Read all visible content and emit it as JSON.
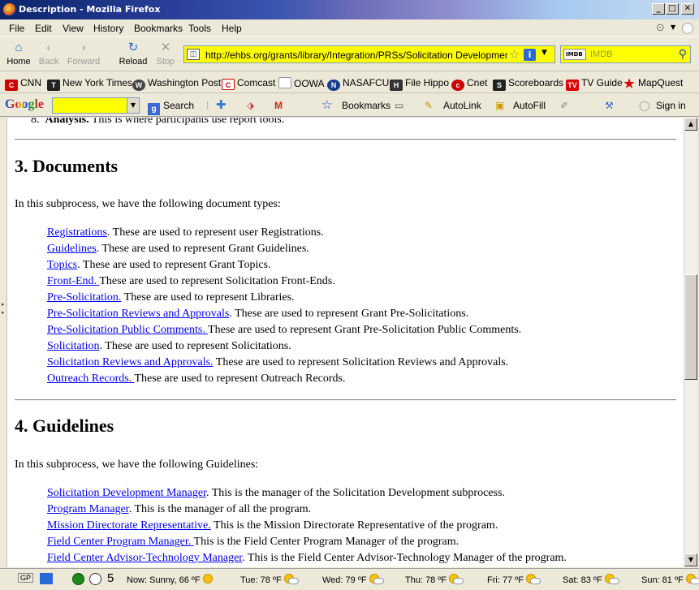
{
  "window": {
    "title": "Description - Mozilla Firefox"
  },
  "menu": [
    "File",
    "Edit",
    "View",
    "History",
    "Bookmarks",
    "Tools",
    "Help"
  ],
  "nav": {
    "home": "Home",
    "back": "Back",
    "forward": "Forward",
    "reload": "Reload",
    "stop": "Stop"
  },
  "address": {
    "url": "http://ehbs.org/grants/library/Integration/PRSs/Solicitation Development/De"
  },
  "search": {
    "engine": "IMDB",
    "placeholder": "IMDB"
  },
  "bookmarks": [
    "CNN",
    "New York Times",
    "Washington Post",
    "Comcast",
    "OOWA",
    "NASAFCU",
    "File Hippo",
    "Cnet",
    "Scoreboards",
    "TV Guide",
    "MapQuest"
  ],
  "google_toolbar": {
    "logo": "Google",
    "search": "Search",
    "bookmarks": "Bookmarks",
    "autolink": "AutoLink",
    "autofill": "AutoFill",
    "signin": "Sign in"
  },
  "content": {
    "prev_item": {
      "num": "8.",
      "bold": "Analysis.",
      "text": " This is where participants use report tools."
    },
    "documents": {
      "heading": "3. Documents",
      "intro": "In this subprocess, we have the following document types:",
      "items": [
        {
          "link": "Registrations",
          "text": ". These are used to represent user Registrations."
        },
        {
          "link": "Guidelines",
          "text": ". These are used to represent Grant Guidelines."
        },
        {
          "link": "Topics",
          "text": ". These are used to represent Grant Topics."
        },
        {
          "link": "Front-End. ",
          "text": "These are used to represent Solicitation Front-Ends."
        },
        {
          "link": "Pre-Solicitation.",
          "text": " These are used to represent Libraries."
        },
        {
          "link": "Pre-Solicitation Reviews and Approvals",
          "text": ". These are used to represent Grant Pre-Solicitations."
        },
        {
          "link": "Pre-Solicitation Public Comments. ",
          "text": "These are used to represent Grant Pre-Solicitation Public Comments."
        },
        {
          "link": "Solicitation",
          "text": ". These are used to represent Solicitations."
        },
        {
          "link": "Solicitation Reviews and Approvals.",
          "text": " These are used to represent Solicitation Reviews and Approvals."
        },
        {
          "link": "Outreach Records. ",
          "text": "These are used to represent Outreach Records."
        }
      ]
    },
    "guidelines": {
      "heading": "4. Guidelines",
      "intro": "In this subprocess, we have the following Guidelines:",
      "items": [
        {
          "link": "Solicitation Development Manager",
          "text": ". This is the manager of the Solicitation Development subprocess."
        },
        {
          "link": "Program Manager",
          "text": ". This is the manager of all the program."
        },
        {
          "link": "Mission Directorate Representative.",
          "text": " This is the Mission Directorate Representative of the program."
        },
        {
          "link": "Field Center Program Manager. ",
          "text": "This is the Field Center Program Manager of the program."
        },
        {
          "link": "Field Center Advisor-Technology Manager",
          "text": ". This is the Field Center Advisor-Technology Manager of the program."
        }
      ]
    }
  },
  "status": {
    "gp": "GP",
    "count": "5",
    "now": "Now: Sunny, 66 ºF",
    "forecast": [
      "Tue: 78 ºF",
      "Wed: 79 ºF",
      "Thu: 78 ºF",
      "Fri: 77 ºF",
      "Sat: 83 ºF",
      "Sun: 81 ºF"
    ]
  }
}
